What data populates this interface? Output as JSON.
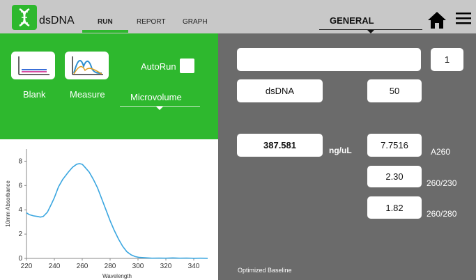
{
  "header": {
    "app_name": "dsDNA",
    "tabs": [
      {
        "label": "RUN",
        "active": true
      },
      {
        "label": "REPORT",
        "active": false
      },
      {
        "label": "GRAPH",
        "active": false
      }
    ],
    "mode_select": "GENERAL",
    "home_icon": "home-icon",
    "menu_icon": "hamburger-menu-icon",
    "accent_color": "#2eb82e"
  },
  "controls": {
    "blank_label": "Blank",
    "measure_label": "Measure",
    "autorun_label": "AutoRun",
    "autorun_checked": false,
    "volume_mode": "Microvolume"
  },
  "chart_data": {
    "type": "line",
    "xlabel": "Wavelength",
    "ylabel": "10mm Absorbance",
    "xlim": [
      220,
      350
    ],
    "ylim": [
      0,
      9
    ],
    "x_ticks": [
      220,
      240,
      260,
      280,
      300,
      320,
      340
    ],
    "y_ticks": [
      0,
      2,
      4,
      6,
      8
    ],
    "grid": false,
    "series": [
      {
        "color": "#3aa6e0",
        "x": [
          220,
          222,
          225,
          228,
          230,
          232,
          235,
          238,
          240,
          243,
          246,
          250,
          253,
          256,
          258,
          260,
          262,
          265,
          268,
          271,
          274,
          277,
          280,
          283,
          286,
          289,
          292,
          295,
          298,
          301,
          305,
          310,
          315,
          320,
          325,
          330,
          335,
          340,
          345,
          350
        ],
        "y": [
          3.75,
          3.6,
          3.5,
          3.45,
          3.4,
          3.45,
          3.8,
          4.5,
          5.0,
          5.9,
          6.5,
          7.1,
          7.5,
          7.75,
          7.8,
          7.75,
          7.5,
          7.1,
          6.5,
          5.8,
          4.9,
          4.0,
          3.1,
          2.3,
          1.6,
          1.0,
          0.55,
          0.3,
          0.15,
          0.08,
          0.05,
          0.02,
          0.03,
          0.02,
          0.04,
          0.02,
          0.03,
          0.01,
          0.02,
          0.01
        ]
      }
    ]
  },
  "results": {
    "sample_name": "",
    "sample_count": "1",
    "sample_type": "dsDNA",
    "factor": "50",
    "concentration": "387.581",
    "concentration_unit": "ng/uL",
    "a260_value": "7.7516",
    "a260_label": "A260",
    "ratio_230_value": "2.30",
    "ratio_230_label": "260/230",
    "ratio_280_value": "1.82",
    "ratio_280_label": "260/280",
    "baseline_note": "Optimized Baseline"
  }
}
